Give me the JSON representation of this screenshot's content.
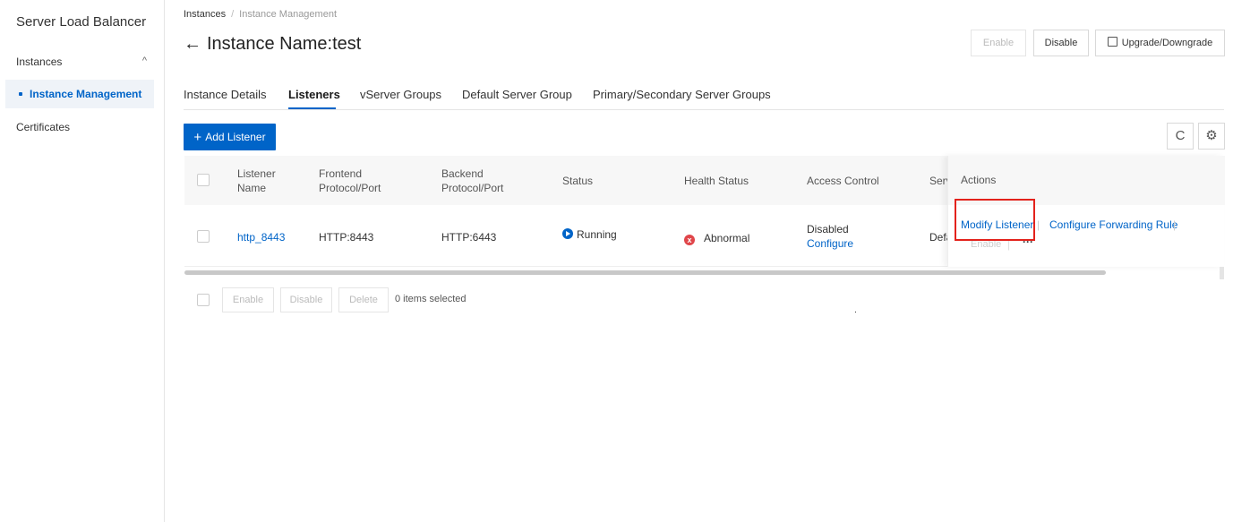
{
  "sidebar": {
    "title": "Server Load Balancer",
    "group_label": "Instances",
    "group_chevron": "^",
    "active_item": "Instance Management",
    "item_certificates": "Certificates"
  },
  "breadcrumb": {
    "first": "Instances",
    "sep": "/",
    "second": "Instance Management"
  },
  "header": {
    "back_arrow": "←",
    "title": "Instance Name:test",
    "btn_enable": "Enable",
    "btn_disable": "Disable",
    "btn_upgrade": "Upgrade/Downgrade"
  },
  "tabs": [
    {
      "label": "Instance Details"
    },
    {
      "label": "Listeners",
      "active": true
    },
    {
      "label": "vServer Groups"
    },
    {
      "label": "Default Server Group"
    },
    {
      "label": "Primary/Secondary Server Groups"
    }
  ],
  "toolbar": {
    "add_plus": "+",
    "add_label": "Add Listener",
    "refresh_icon": "C",
    "settings_icon": "⚙"
  },
  "table": {
    "headers": {
      "name_line1": "Listener",
      "name_line2": "Name",
      "frontend_line1": "Frontend",
      "frontend_line2": "Protocol/Port",
      "backend_line1": "Backend",
      "backend_line2": "Protocol/Port",
      "status": "Status",
      "health": "Health Status",
      "access": "Access Control",
      "server_partial": "Serv",
      "actions": "Actions"
    },
    "row": {
      "name": "http_8443",
      "frontend": "HTTP:8443",
      "backend": "HTTP:6443",
      "status": "Running",
      "health_icon": "x",
      "health": "Abnormal",
      "access_line1": "Disabled",
      "access_line2": "Configure",
      "server_partial": "Defa",
      "action_modify": "Modify Listener",
      "action_sep": "|",
      "action_forward": "Configure Forwarding Rule",
      "action_enable": "Enable",
      "action_more": "···"
    }
  },
  "footer": {
    "btn_enable": "Enable",
    "btn_disable": "Disable",
    "btn_delete": "Delete",
    "selected_text": "0 items selected"
  },
  "colors": {
    "accent": "#0064c8",
    "highlight": "#e3221c",
    "error": "#e0464a"
  }
}
